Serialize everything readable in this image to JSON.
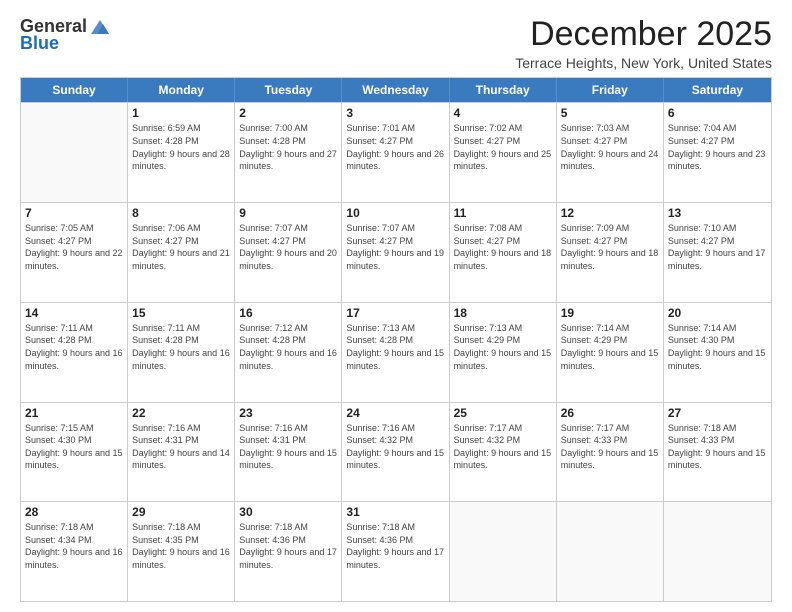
{
  "logo": {
    "general": "General",
    "blue": "Blue"
  },
  "title": "December 2025",
  "location": "Terrace Heights, New York, United States",
  "days_header": [
    "Sunday",
    "Monday",
    "Tuesday",
    "Wednesday",
    "Thursday",
    "Friday",
    "Saturday"
  ],
  "weeks": [
    [
      {
        "day": "",
        "sunrise": "",
        "sunset": "",
        "daylight": ""
      },
      {
        "day": "1",
        "sunrise": "Sunrise: 6:59 AM",
        "sunset": "Sunset: 4:28 PM",
        "daylight": "Daylight: 9 hours and 28 minutes."
      },
      {
        "day": "2",
        "sunrise": "Sunrise: 7:00 AM",
        "sunset": "Sunset: 4:28 PM",
        "daylight": "Daylight: 9 hours and 27 minutes."
      },
      {
        "day": "3",
        "sunrise": "Sunrise: 7:01 AM",
        "sunset": "Sunset: 4:27 PM",
        "daylight": "Daylight: 9 hours and 26 minutes."
      },
      {
        "day": "4",
        "sunrise": "Sunrise: 7:02 AM",
        "sunset": "Sunset: 4:27 PM",
        "daylight": "Daylight: 9 hours and 25 minutes."
      },
      {
        "day": "5",
        "sunrise": "Sunrise: 7:03 AM",
        "sunset": "Sunset: 4:27 PM",
        "daylight": "Daylight: 9 hours and 24 minutes."
      },
      {
        "day": "6",
        "sunrise": "Sunrise: 7:04 AM",
        "sunset": "Sunset: 4:27 PM",
        "daylight": "Daylight: 9 hours and 23 minutes."
      }
    ],
    [
      {
        "day": "7",
        "sunrise": "Sunrise: 7:05 AM",
        "sunset": "Sunset: 4:27 PM",
        "daylight": "Daylight: 9 hours and 22 minutes."
      },
      {
        "day": "8",
        "sunrise": "Sunrise: 7:06 AM",
        "sunset": "Sunset: 4:27 PM",
        "daylight": "Daylight: 9 hours and 21 minutes."
      },
      {
        "day": "9",
        "sunrise": "Sunrise: 7:07 AM",
        "sunset": "Sunset: 4:27 PM",
        "daylight": "Daylight: 9 hours and 20 minutes."
      },
      {
        "day": "10",
        "sunrise": "Sunrise: 7:07 AM",
        "sunset": "Sunset: 4:27 PM",
        "daylight": "Daylight: 9 hours and 19 minutes."
      },
      {
        "day": "11",
        "sunrise": "Sunrise: 7:08 AM",
        "sunset": "Sunset: 4:27 PM",
        "daylight": "Daylight: 9 hours and 18 minutes."
      },
      {
        "day": "12",
        "sunrise": "Sunrise: 7:09 AM",
        "sunset": "Sunset: 4:27 PM",
        "daylight": "Daylight: 9 hours and 18 minutes."
      },
      {
        "day": "13",
        "sunrise": "Sunrise: 7:10 AM",
        "sunset": "Sunset: 4:27 PM",
        "daylight": "Daylight: 9 hours and 17 minutes."
      }
    ],
    [
      {
        "day": "14",
        "sunrise": "Sunrise: 7:11 AM",
        "sunset": "Sunset: 4:28 PM",
        "daylight": "Daylight: 9 hours and 16 minutes."
      },
      {
        "day": "15",
        "sunrise": "Sunrise: 7:11 AM",
        "sunset": "Sunset: 4:28 PM",
        "daylight": "Daylight: 9 hours and 16 minutes."
      },
      {
        "day": "16",
        "sunrise": "Sunrise: 7:12 AM",
        "sunset": "Sunset: 4:28 PM",
        "daylight": "Daylight: 9 hours and 16 minutes."
      },
      {
        "day": "17",
        "sunrise": "Sunrise: 7:13 AM",
        "sunset": "Sunset: 4:28 PM",
        "daylight": "Daylight: 9 hours and 15 minutes."
      },
      {
        "day": "18",
        "sunrise": "Sunrise: 7:13 AM",
        "sunset": "Sunset: 4:29 PM",
        "daylight": "Daylight: 9 hours and 15 minutes."
      },
      {
        "day": "19",
        "sunrise": "Sunrise: 7:14 AM",
        "sunset": "Sunset: 4:29 PM",
        "daylight": "Daylight: 9 hours and 15 minutes."
      },
      {
        "day": "20",
        "sunrise": "Sunrise: 7:14 AM",
        "sunset": "Sunset: 4:30 PM",
        "daylight": "Daylight: 9 hours and 15 minutes."
      }
    ],
    [
      {
        "day": "21",
        "sunrise": "Sunrise: 7:15 AM",
        "sunset": "Sunset: 4:30 PM",
        "daylight": "Daylight: 9 hours and 15 minutes."
      },
      {
        "day": "22",
        "sunrise": "Sunrise: 7:16 AM",
        "sunset": "Sunset: 4:31 PM",
        "daylight": "Daylight: 9 hours and 14 minutes."
      },
      {
        "day": "23",
        "sunrise": "Sunrise: 7:16 AM",
        "sunset": "Sunset: 4:31 PM",
        "daylight": "Daylight: 9 hours and 15 minutes."
      },
      {
        "day": "24",
        "sunrise": "Sunrise: 7:16 AM",
        "sunset": "Sunset: 4:32 PM",
        "daylight": "Daylight: 9 hours and 15 minutes."
      },
      {
        "day": "25",
        "sunrise": "Sunrise: 7:17 AM",
        "sunset": "Sunset: 4:32 PM",
        "daylight": "Daylight: 9 hours and 15 minutes."
      },
      {
        "day": "26",
        "sunrise": "Sunrise: 7:17 AM",
        "sunset": "Sunset: 4:33 PM",
        "daylight": "Daylight: 9 hours and 15 minutes."
      },
      {
        "day": "27",
        "sunrise": "Sunrise: 7:18 AM",
        "sunset": "Sunset: 4:33 PM",
        "daylight": "Daylight: 9 hours and 15 minutes."
      }
    ],
    [
      {
        "day": "28",
        "sunrise": "Sunrise: 7:18 AM",
        "sunset": "Sunset: 4:34 PM",
        "daylight": "Daylight: 9 hours and 16 minutes."
      },
      {
        "day": "29",
        "sunrise": "Sunrise: 7:18 AM",
        "sunset": "Sunset: 4:35 PM",
        "daylight": "Daylight: 9 hours and 16 minutes."
      },
      {
        "day": "30",
        "sunrise": "Sunrise: 7:18 AM",
        "sunset": "Sunset: 4:36 PM",
        "daylight": "Daylight: 9 hours and 17 minutes."
      },
      {
        "day": "31",
        "sunrise": "Sunrise: 7:18 AM",
        "sunset": "Sunset: 4:36 PM",
        "daylight": "Daylight: 9 hours and 17 minutes."
      },
      {
        "day": "",
        "sunrise": "",
        "sunset": "",
        "daylight": ""
      },
      {
        "day": "",
        "sunrise": "",
        "sunset": "",
        "daylight": ""
      },
      {
        "day": "",
        "sunrise": "",
        "sunset": "",
        "daylight": ""
      }
    ]
  ]
}
